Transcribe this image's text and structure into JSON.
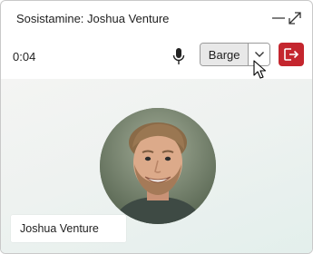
{
  "window": {
    "title": "Sosistamine: Joshua Venture",
    "minimize_icon": "minimize-icon",
    "expand_icon": "expand-icon"
  },
  "call": {
    "timer": "0:04",
    "mic_icon": "microphone-icon",
    "barge_label": "Barge",
    "dropdown_icon": "chevron-down-icon",
    "leave_icon": "leave-call-icon",
    "leave_color": "#c4262e"
  },
  "participant": {
    "name": "Joshua Venture",
    "avatar": "participant-photo"
  },
  "colors": {
    "accent_red": "#c4262e",
    "stage_tint": "#e3efec"
  }
}
